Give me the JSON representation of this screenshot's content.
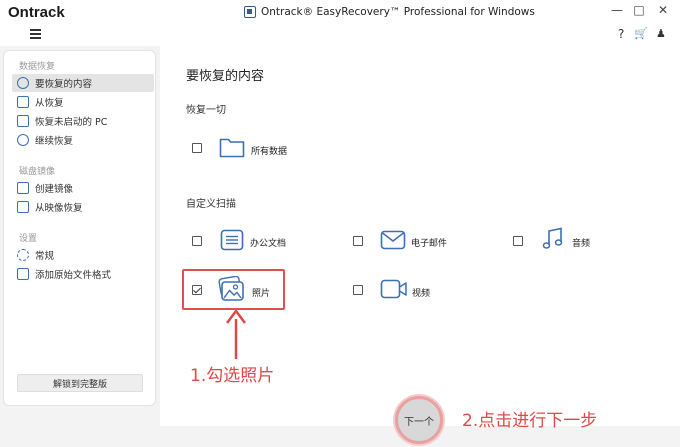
{
  "window": {
    "brand": "Ontrack",
    "title": "Ontrack® EasyRecovery™ Professional for Windows",
    "minimize": "—",
    "maximize": "□",
    "close": "✕"
  },
  "toolbar": {
    "help": "?",
    "cart": "🛒",
    "user": "♟"
  },
  "sidebar": {
    "sections": [
      {
        "title": "数据恢复"
      },
      {
        "title": "磁盘镜像"
      },
      {
        "title": "设置"
      }
    ],
    "items": [
      {
        "label": "要恢复的内容",
        "icon": "target-icon",
        "active": true
      },
      {
        "label": "从恢复",
        "icon": "drive-icon"
      },
      {
        "label": "恢复未启动的 PC",
        "icon": "pc-icon"
      },
      {
        "label": "继续恢复",
        "icon": "resume-icon"
      },
      {
        "label": "创建镜像",
        "icon": "create-image-icon"
      },
      {
        "label": "从映像恢复",
        "icon": "restore-image-icon"
      },
      {
        "label": "常规",
        "icon": "gear-icon"
      },
      {
        "label": "添加原始文件格式",
        "icon": "file-format-icon"
      }
    ],
    "unlock_label": "解锁到完整版"
  },
  "main": {
    "title": "要恢复的内容",
    "section_all": "恢复一切",
    "section_custom": "自定义扫描",
    "options": [
      {
        "label": "所有数据",
        "checked": false,
        "icon": "folder-icon"
      },
      {
        "label": "办公文档",
        "checked": false,
        "icon": "document-icon"
      },
      {
        "label": "电子邮件",
        "checked": false,
        "icon": "email-icon"
      },
      {
        "label": "音频",
        "checked": false,
        "icon": "music-icon"
      },
      {
        "label": "照片",
        "checked": true,
        "icon": "photo-icon"
      },
      {
        "label": "视频",
        "checked": false,
        "icon": "video-icon"
      }
    ],
    "next_label": "下一个"
  },
  "annotations": {
    "step1": "1.勾选照片",
    "step2": "2.点击进行下一步"
  },
  "colors": {
    "accent": "#3d6fb2",
    "annotation": "#e04848"
  }
}
